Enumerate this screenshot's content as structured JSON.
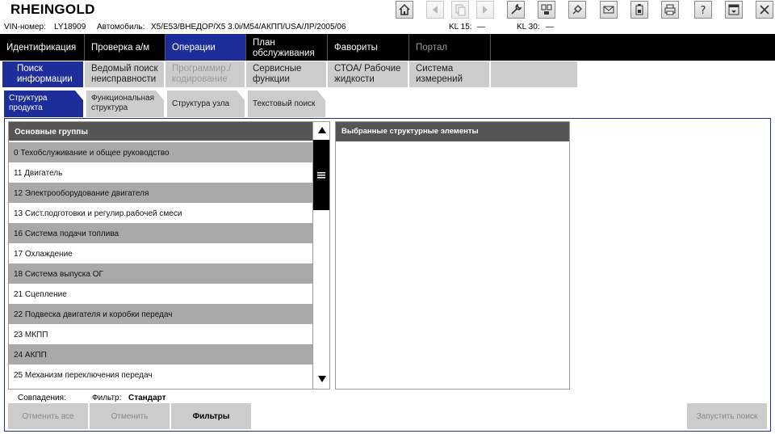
{
  "app": {
    "title": "RHEINGOLD"
  },
  "toolbar": {
    "buttons": [
      {
        "icon": "home-icon"
      },
      {
        "icon": "arrow-left-icon"
      },
      {
        "icon": "document-icon"
      },
      {
        "icon": "arrow-right-icon"
      },
      {
        "icon": "wrench-icon"
      },
      {
        "icon": "diagnostics-icon"
      },
      {
        "icon": "plug-icon"
      },
      {
        "icon": "mail-icon"
      },
      {
        "icon": "battery-icon"
      },
      {
        "icon": "printer-icon"
      },
      {
        "icon": "help-icon"
      },
      {
        "icon": "minimize-icon"
      },
      {
        "icon": "close-icon"
      }
    ]
  },
  "vehicle": {
    "vin_label": "VIN-номер:",
    "vin_value": "LY18909",
    "car_label": "Автомобиль:",
    "car_value": "X5/E53/ВНЕДОР/X5 3.0i/M54/АКПП/USA/ЛР/2005/06",
    "kl15_label": "KL 15:",
    "kl15_value": "—",
    "kl30_label": "KL 30:",
    "kl30_value": "—"
  },
  "main_nav": [
    {
      "label": "Идентификация",
      "active": false
    },
    {
      "label": "Проверка а/м",
      "active": false
    },
    {
      "label": "Операции",
      "active": true
    },
    {
      "label": "План обслуживания",
      "active": false
    },
    {
      "label": "Фавориты",
      "active": false
    },
    {
      "label": "Портал",
      "active": false
    }
  ],
  "sub_nav": [
    {
      "label": "Поиск информации",
      "active": true
    },
    {
      "label": "Ведомый поиск неисправности",
      "active": false
    },
    {
      "label": "Программир./ кодирование",
      "disabled": true
    },
    {
      "label": "Сервисные функции",
      "active": false
    },
    {
      "label": "СТОА/ Рабочие жидкости",
      "active": false
    },
    {
      "label": "Система измерений",
      "active": false
    }
  ],
  "tabs": [
    {
      "label": "Структура продукта",
      "active": true
    },
    {
      "label": "Функциональная структура",
      "active": false
    },
    {
      "label": "Структура узла",
      "active": false
    },
    {
      "label": "Текстовый поиск",
      "active": false
    }
  ],
  "list": {
    "header": "Основные группы",
    "rows": [
      "0 Техобслуживание и общее руководство",
      "11 Двигатель",
      "12 Электрооборудование двигателя",
      "13 Сист.подготовки и регулир.рабочей смеси",
      "16 Система подачи топлива",
      "17 Охлаждение",
      "18 Система выпуска ОГ",
      "21 Сцепление",
      "22 Подвеска двигателя и коробки передач",
      "23 МКПП",
      "24 АКПП",
      "25 Механизм переключения передач"
    ]
  },
  "selected_panel": {
    "header": "Выбранные структурные элементы"
  },
  "footer": {
    "matches_label": "Совпадения:",
    "filter_label": "Фильтр:",
    "filter_value": "Стандарт",
    "cancel_all": "Отменить все",
    "cancel": "Отменить",
    "filters": "Фильтры",
    "start_search": "Запустить поиск"
  },
  "colors": {
    "accent": "#1d2d9a",
    "header_gray": "#555555",
    "row_gray": "#a9a9a9",
    "tab_gray": "#cccccc"
  }
}
